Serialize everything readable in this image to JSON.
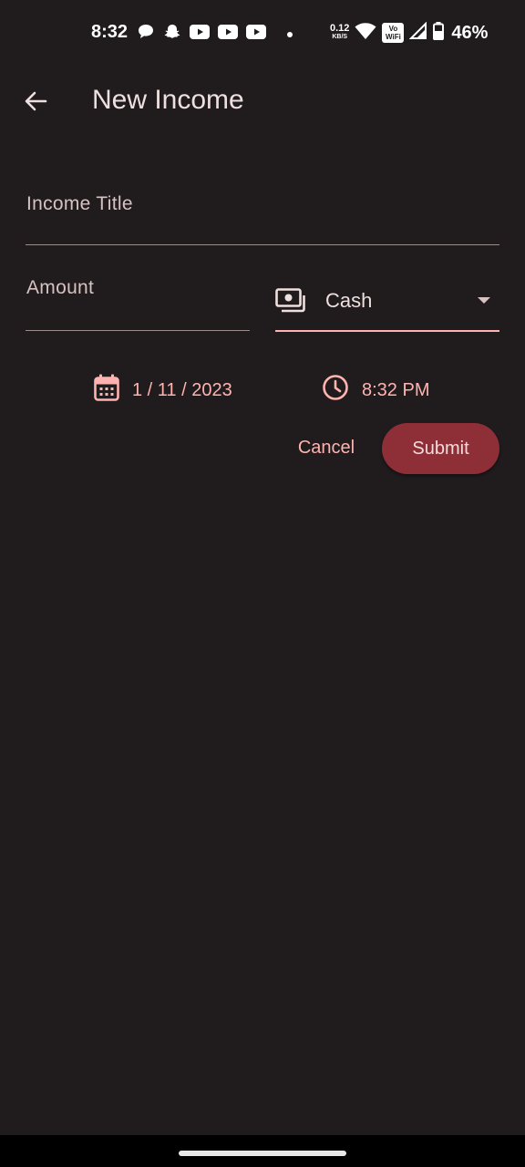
{
  "status_bar": {
    "time": "8:32",
    "net_speed_value": "0.12",
    "net_speed_unit": "KB/S",
    "vowifi_top": "Vo",
    "vowifi_bottom": "WiFi",
    "battery_percent": "46%",
    "icons_left": [
      "chat-icon",
      "snapchat-icon",
      "youtube-icon",
      "youtube-icon",
      "youtube-icon",
      "dot-icon"
    ],
    "icons_right": [
      "wifi-icon",
      "signal-icon",
      "battery-icon"
    ]
  },
  "app_bar": {
    "title": "New Income",
    "back_icon": "arrow-back-icon"
  },
  "form": {
    "income_title_label": "Income Title",
    "amount_label": "Amount",
    "payment_method": {
      "selected": "Cash",
      "icon": "cash-icon"
    },
    "date": "1 / 11 / 2023",
    "time": "8:32 PM"
  },
  "actions": {
    "cancel_label": "Cancel",
    "submit_label": "Submit"
  },
  "colors": {
    "background": "#201b1c",
    "accent": "#ffb3b1",
    "submit_bg": "#8e2f38",
    "text": "#ede0df"
  }
}
